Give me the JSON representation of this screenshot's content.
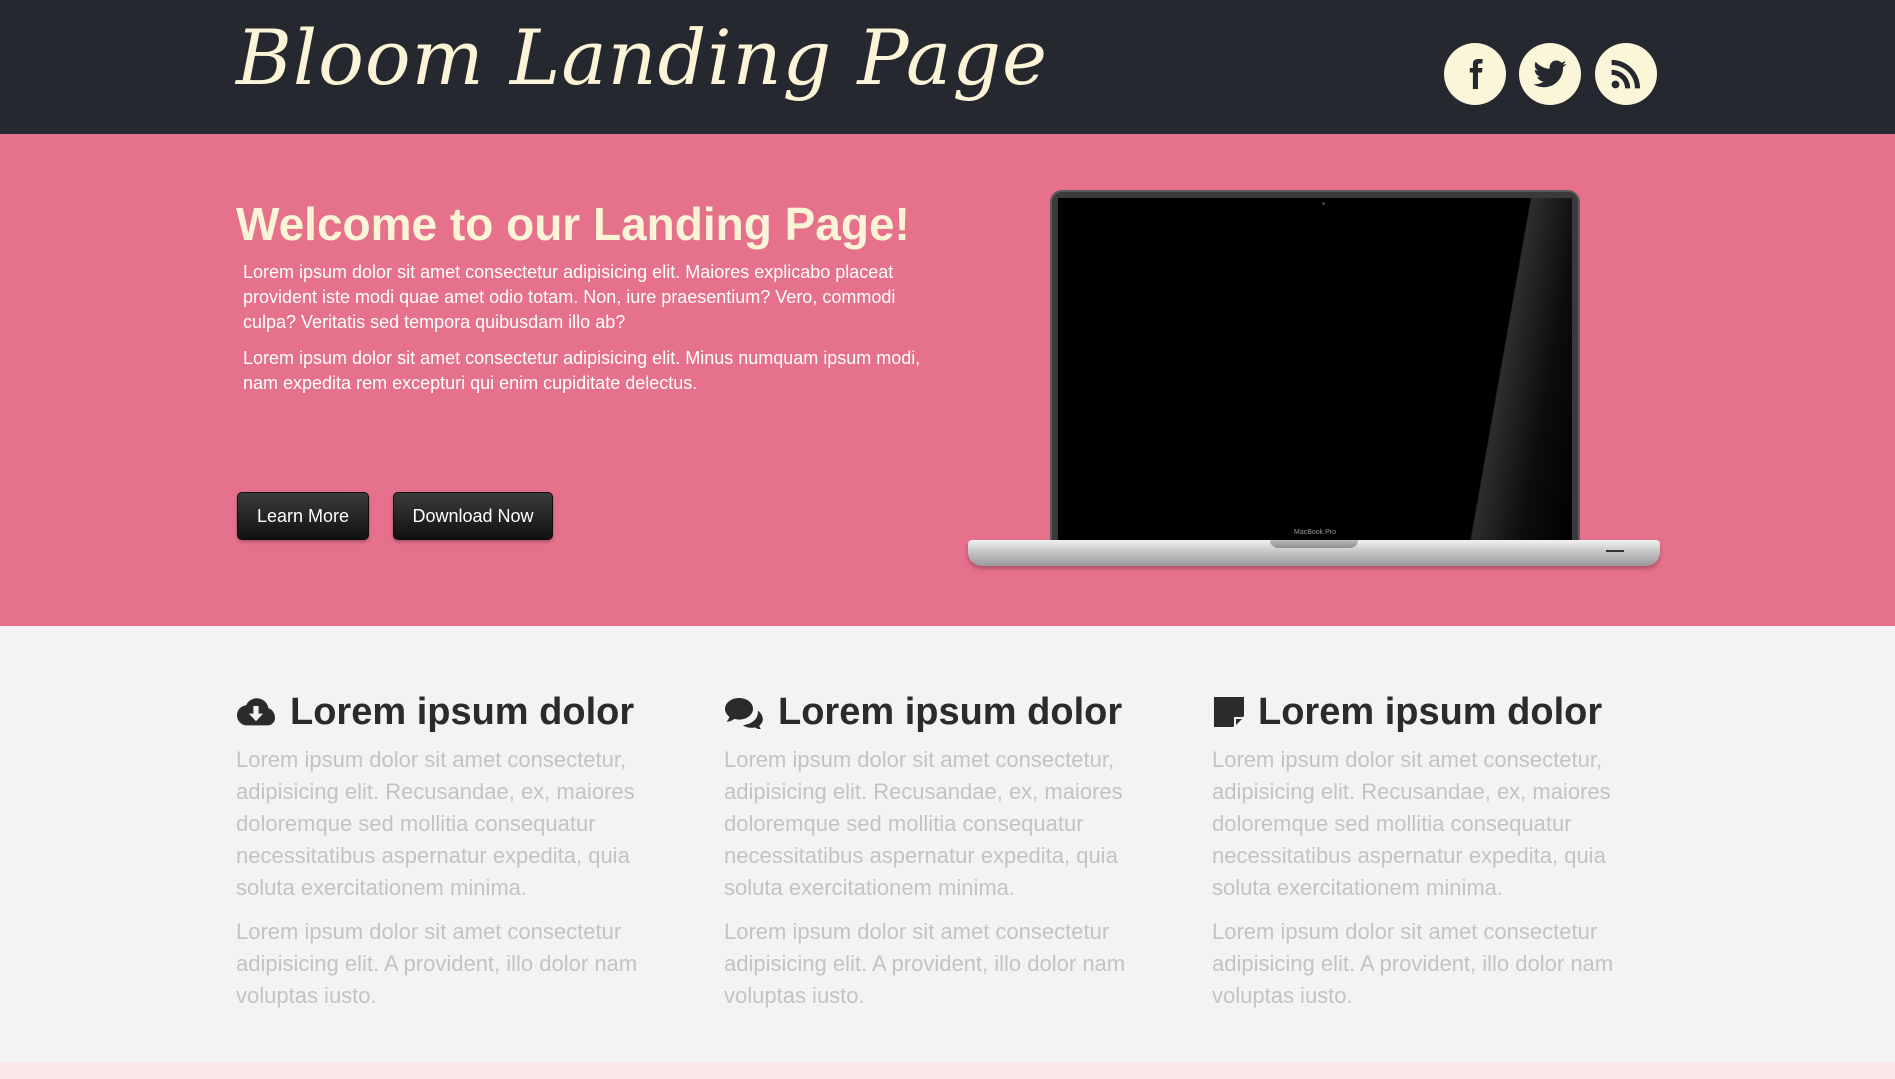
{
  "header": {
    "brand": "Bloom Landing Page",
    "social": [
      {
        "icon": "facebook-icon"
      },
      {
        "icon": "twitter-icon"
      },
      {
        "icon": "rss-icon"
      }
    ]
  },
  "hero": {
    "title": "Welcome to our Landing Page!",
    "paragraph1": "Lorem ipsum dolor sit amet consectetur adipisicing elit. Maiores explicabo placeat provident iste modi quae amet odio totam. Non, iure praesentium? Vero, commodi culpa? Veritatis sed tempora quibusdam illo ab?",
    "paragraph2": "Lorem ipsum dolor sit amet consectetur adipisicing elit. Minus numquam ipsum modi, nam expedita rem excepturi qui enim cupiditate delectus.",
    "learn_more_label": "Learn More",
    "download_label": "Download Now",
    "laptop_model_text": "MacBook Pro"
  },
  "features": [
    {
      "icon": "cloud-download-icon",
      "title": "Lorem ipsum dolor",
      "paragraph1": "Lorem ipsum dolor sit amet consectetur, adipisicing elit. Recusandae, ex, maiores doloremque sed mollitia consequatur necessitatibus aspernatur expedita, quia soluta exercitationem minima.",
      "paragraph2": "Lorem ipsum dolor sit amet consectetur adipisicing elit. A provident, illo dolor nam voluptas iusto."
    },
    {
      "icon": "comments-icon",
      "title": "Lorem ipsum dolor",
      "paragraph1": "Lorem ipsum dolor sit amet consectetur, adipisicing elit. Recusandae, ex, maiores doloremque sed mollitia consequatur necessitatibus aspernatur expedita, quia soluta exercitationem minima.",
      "paragraph2": "Lorem ipsum dolor sit amet consectetur adipisicing elit. A provident, illo dolor nam voluptas iusto."
    },
    {
      "icon": "sticky-note-icon",
      "title": "Lorem ipsum dolor",
      "paragraph1": "Lorem ipsum dolor sit amet consectetur, adipisicing elit. Recusandae, ex, maiores doloremque sed mollitia consequatur necessitatibus aspernatur expedita, quia soluta exercitationem minima.",
      "paragraph2": "Lorem ipsum dolor sit amet consectetur adipisicing elit. A provident, illo dolor nam voluptas iusto."
    }
  ],
  "colors": {
    "header_bg": "#25282e",
    "hero_bg": "#e6718a",
    "cream": "#fbf4d6",
    "features_bg": "#f3f3f5"
  }
}
